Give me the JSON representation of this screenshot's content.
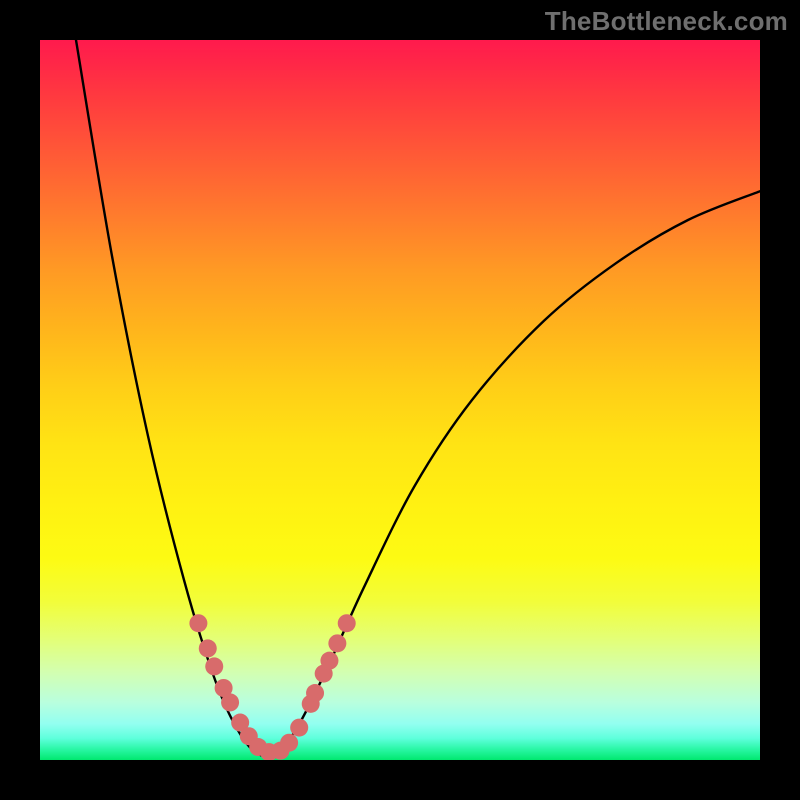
{
  "watermark": "TheBottleneck.com",
  "chart_data": {
    "type": "line",
    "title": "",
    "xlabel": "",
    "ylabel": "",
    "xlim": [
      0,
      100
    ],
    "ylim": [
      0,
      100
    ],
    "grid": false,
    "legend": false,
    "curve": {
      "points": [
        {
          "x": 5,
          "y": 100
        },
        {
          "x": 10,
          "y": 70
        },
        {
          "x": 15,
          "y": 45
        },
        {
          "x": 20,
          "y": 25
        },
        {
          "x": 24,
          "y": 12
        },
        {
          "x": 27,
          "y": 5
        },
        {
          "x": 30,
          "y": 1
        },
        {
          "x": 33,
          "y": 1
        },
        {
          "x": 36,
          "y": 5
        },
        {
          "x": 40,
          "y": 13
        },
        {
          "x": 45,
          "y": 24
        },
        {
          "x": 52,
          "y": 38
        },
        {
          "x": 60,
          "y": 50
        },
        {
          "x": 70,
          "y": 61
        },
        {
          "x": 80,
          "y": 69
        },
        {
          "x": 90,
          "y": 75
        },
        {
          "x": 100,
          "y": 79
        }
      ]
    },
    "markers": {
      "color": "#d86b6b",
      "radius": 9,
      "points": [
        {
          "x": 22,
          "y": 19
        },
        {
          "x": 23.3,
          "y": 15.5
        },
        {
          "x": 24.2,
          "y": 13
        },
        {
          "x": 25.5,
          "y": 10
        },
        {
          "x": 26.4,
          "y": 8
        },
        {
          "x": 27.8,
          "y": 5.2
        },
        {
          "x": 29,
          "y": 3.3
        },
        {
          "x": 30.3,
          "y": 1.8
        },
        {
          "x": 31.8,
          "y": 1.1
        },
        {
          "x": 33.4,
          "y": 1.3
        },
        {
          "x": 34.6,
          "y": 2.4
        },
        {
          "x": 36,
          "y": 4.5
        },
        {
          "x": 37.6,
          "y": 7.8
        },
        {
          "x": 38.2,
          "y": 9.3
        },
        {
          "x": 39.4,
          "y": 12
        },
        {
          "x": 40.2,
          "y": 13.8
        },
        {
          "x": 41.3,
          "y": 16.2
        },
        {
          "x": 42.6,
          "y": 19
        }
      ]
    }
  }
}
